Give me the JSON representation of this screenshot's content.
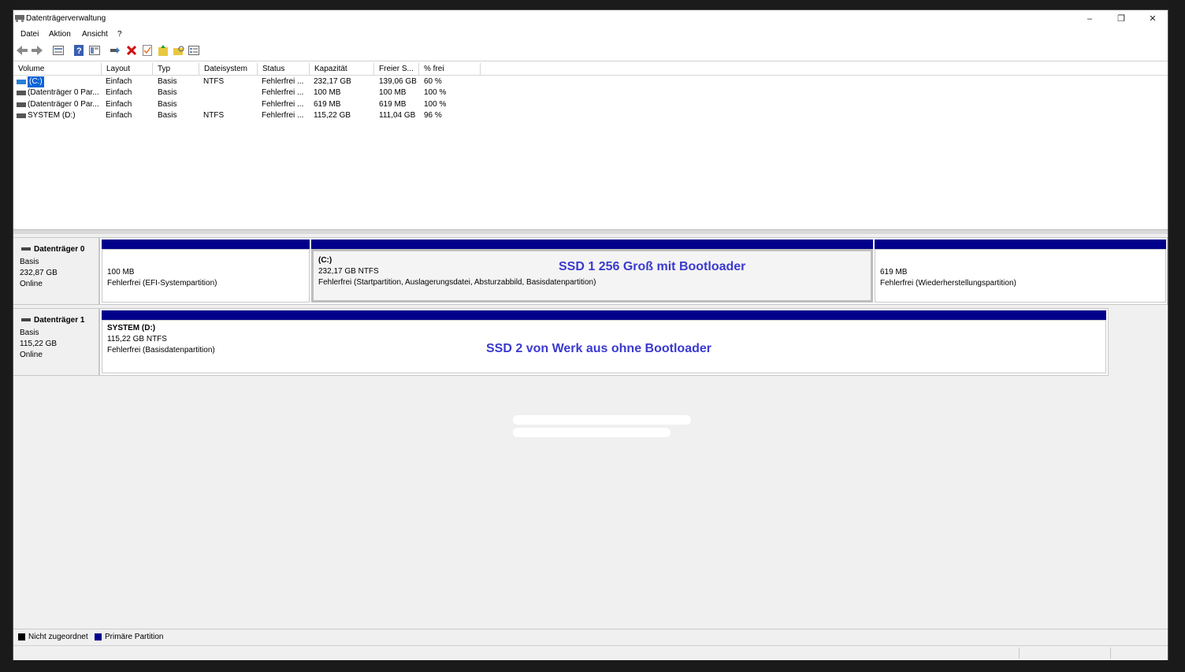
{
  "window": {
    "title": "Datenträgerverwaltung"
  },
  "title_controls": {
    "minimize": "–",
    "restore": "❐",
    "close": "✕"
  },
  "menu": [
    "Datei",
    "Aktion",
    "Ansicht",
    "?"
  ],
  "toolbar_icons": [
    "back-arrow-icon",
    "forward-arrow-icon",
    "disk-list-icon",
    "help-icon",
    "properties-icon",
    "connect-icon",
    "delete-icon",
    "check-icon",
    "new-volume-icon",
    "open-folder-icon",
    "view-icon"
  ],
  "columns": [
    "Volume",
    "Layout",
    "Typ",
    "Dateisystem",
    "Status",
    "Kapazität",
    "Freier S...",
    "% frei"
  ],
  "volumes": [
    {
      "name": "(C:)",
      "layout": "Einfach",
      "type": "Basis",
      "fs": "NTFS",
      "status": "Fehlerfrei ...",
      "capacity": "232,17 GB",
      "free": "139,06 GB",
      "pct": "60 %"
    },
    {
      "name": "(Datenträger 0 Par...",
      "layout": "Einfach",
      "type": "Basis",
      "fs": "",
      "status": "Fehlerfrei ...",
      "capacity": "100 MB",
      "free": "100 MB",
      "pct": "100 %"
    },
    {
      "name": "(Datenträger 0 Par...",
      "layout": "Einfach",
      "type": "Basis",
      "fs": "",
      "status": "Fehlerfrei ...",
      "capacity": "619 MB",
      "free": "619 MB",
      "pct": "100 %"
    },
    {
      "name": "SYSTEM (D:)",
      "layout": "Einfach",
      "type": "Basis",
      "fs": "NTFS",
      "status": "Fehlerfrei ...",
      "capacity": "115,22 GB",
      "free": "111,04 GB",
      "pct": "96 %"
    }
  ],
  "disks": [
    {
      "name": "Datenträger 0",
      "type": "Basis",
      "size": "232,87 GB",
      "state": "Online",
      "partitions": [
        {
          "title": "",
          "line1": "100 MB",
          "line2": "Fehlerfrei (EFI-Systempartition)"
        },
        {
          "title": "(C:)",
          "line1": "232,17 GB NTFS",
          "line2": "Fehlerfrei (Startpartition, Auslagerungsdatei, Absturzabbild, Basisdatenpartition)"
        },
        {
          "title": "",
          "line1": "619 MB",
          "line2": "Fehlerfrei (Wiederherstellungspartition)"
        }
      ]
    },
    {
      "name": "Datenträger 1",
      "type": "Basis",
      "size": "115,22 GB",
      "state": "Online",
      "partitions": [
        {
          "title": "SYSTEM  (D:)",
          "line1": "115,22 GB NTFS",
          "line2": "Fehlerfrei (Basisdatenpartition)"
        }
      ]
    }
  ],
  "annotations": {
    "ssd1": "SSD 1 256 Groß mit Bootloader",
    "ssd2": "SSD 2 von Werk aus ohne Bootloader"
  },
  "legend": [
    {
      "label": "Nicht zugeordnet",
      "color": "#000000"
    },
    {
      "label": "Primäre Partition",
      "color": "#00008b"
    }
  ]
}
